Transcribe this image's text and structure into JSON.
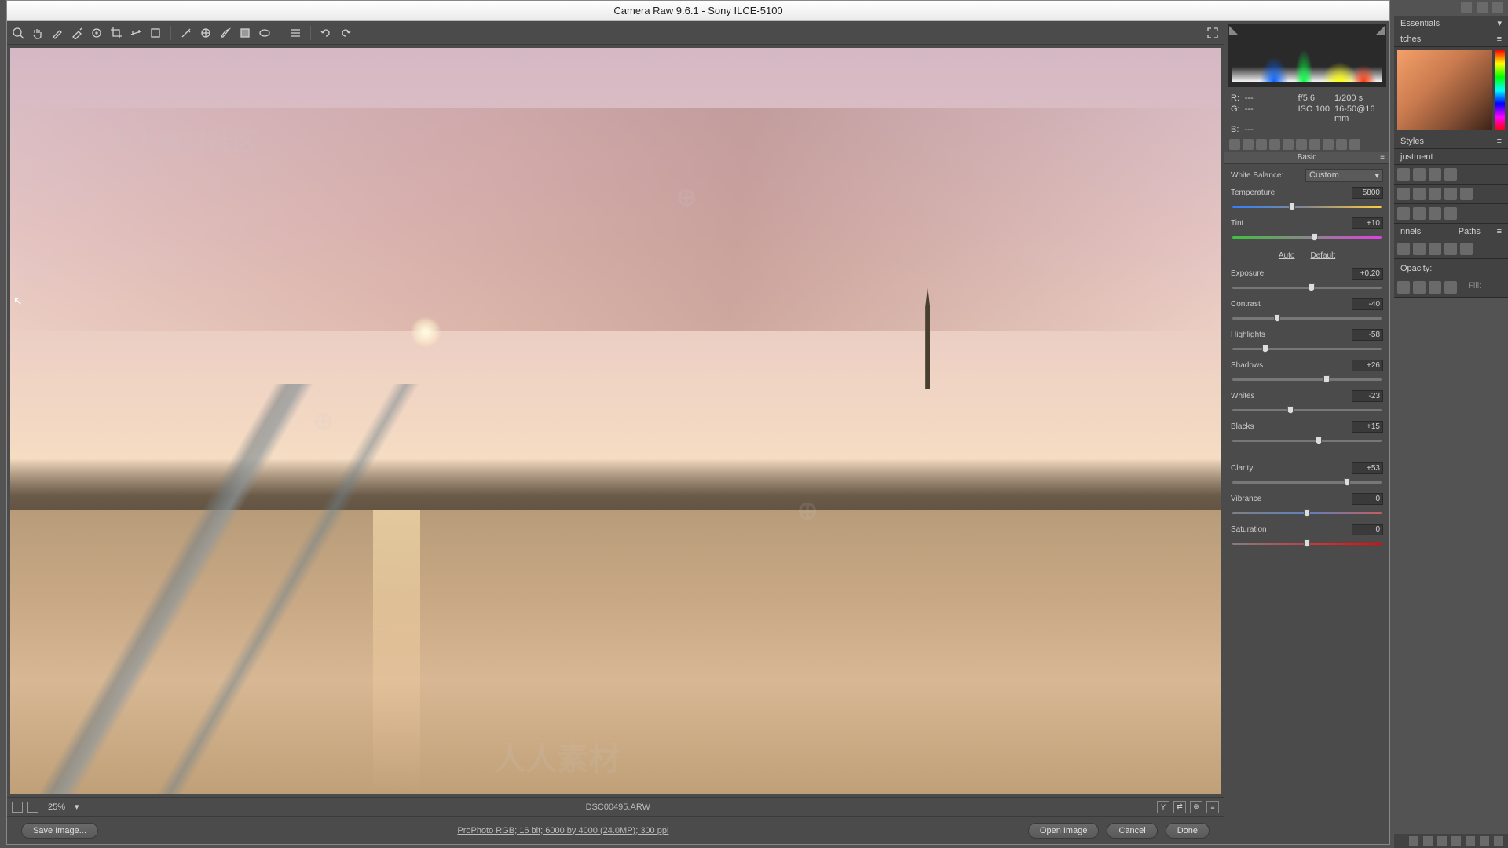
{
  "window": {
    "title": "Camera Raw 9.6.1  -  Sony ILCE-5100"
  },
  "ps": {
    "workspace": "Essentials",
    "swatches_tab": "tches",
    "styles_tab": "Styles",
    "adjust_tab": "justment",
    "channels_tab": "nnels",
    "paths_tab": "Paths",
    "opacity_lbl": "Opacity:",
    "fill_lbl": "Fill:"
  },
  "info": {
    "r": "R:",
    "rv": "---",
    "g": "G:",
    "gv": "---",
    "b": "B:",
    "bv": "---",
    "aperture": "f/5.6",
    "shutter": "1/200 s",
    "iso": "ISO 100",
    "lens": "16-50@16 mm"
  },
  "basic": {
    "title": "Basic",
    "wb_label": "White Balance:",
    "wb_value": "Custom",
    "auto": "Auto",
    "default": "Default",
    "sliders": {
      "temperature": {
        "label": "Temperature",
        "value": "5800",
        "pos": 40
      },
      "tint": {
        "label": "Tint",
        "value": "+10",
        "pos": 55
      },
      "exposure": {
        "label": "Exposure",
        "value": "+0.20",
        "pos": 53
      },
      "contrast": {
        "label": "Contrast",
        "value": "-40",
        "pos": 30
      },
      "highlights": {
        "label": "Highlights",
        "value": "-58",
        "pos": 22
      },
      "shadows": {
        "label": "Shadows",
        "value": "+26",
        "pos": 63
      },
      "whites": {
        "label": "Whites",
        "value": "-23",
        "pos": 39
      },
      "blacks": {
        "label": "Blacks",
        "value": "+15",
        "pos": 58
      },
      "clarity": {
        "label": "Clarity",
        "value": "+53",
        "pos": 77
      },
      "vibrance": {
        "label": "Vibrance",
        "value": "0",
        "pos": 50
      },
      "saturation": {
        "label": "Saturation",
        "value": "0",
        "pos": 50
      }
    }
  },
  "status": {
    "zoom": "25%",
    "filename": "DSC00495.ARW",
    "y": "Y"
  },
  "footer": {
    "save": "Save Image...",
    "info": "ProPhoto RGB; 16 bit; 6000 by 4000 (24.0MP); 300 ppi",
    "open": "Open Image",
    "cancel": "Cancel",
    "done": "Done"
  }
}
